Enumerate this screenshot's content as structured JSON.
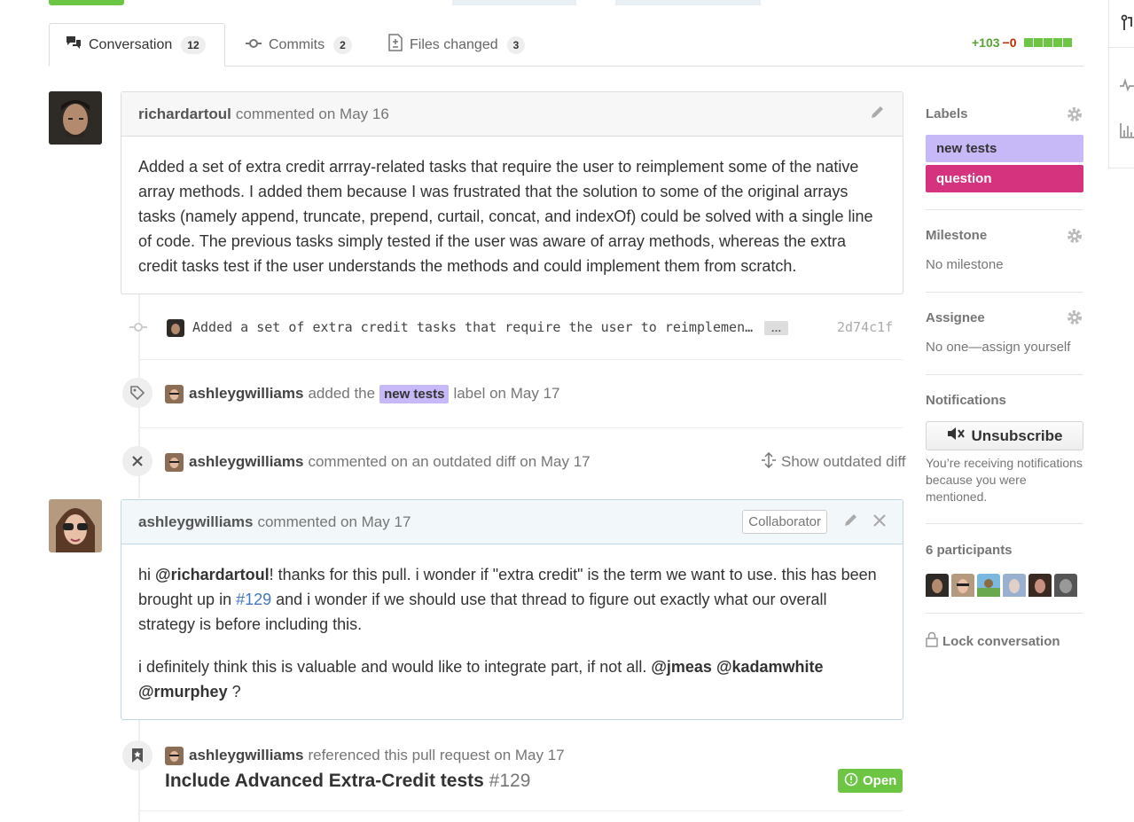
{
  "tabs": [
    {
      "label": "Conversation",
      "count": "12"
    },
    {
      "label": "Commits",
      "count": "2"
    },
    {
      "label": "Files changed",
      "count": "3"
    }
  ],
  "diffstat": {
    "additions": "+103",
    "deletions": "−0"
  },
  "comment1": {
    "author": "richardartoul",
    "action": "commented",
    "date": "on May 16",
    "body": "Added a set of extra credit arrray-related tasks that require the user to reimplement some of the native array methods. I added them because I was frustrated that the solution to some of the original arrays tasks (namely append, truncate, prepend, curtail, concat, and indexOf) could be solved with a single line of code. The previous tasks simply tested if the user was aware of array methods, whereas the extra credit tasks test if the user understands the methods and could implement them from scratch."
  },
  "commit": {
    "message": "Added a set of extra credit tasks that require the user to reimplemen…",
    "ellipsis": "…",
    "sha": "2d74c1f"
  },
  "label_event": {
    "author": "ashleygwilliams",
    "pre": "added the",
    "label": "new tests",
    "post": "label on May 17"
  },
  "outdated_event": {
    "author": "ashleygwilliams",
    "text": "commented on an outdated diff on May 17",
    "show": "Show outdated diff"
  },
  "comment2": {
    "author": "ashleygwilliams",
    "action": "commented",
    "date": "on May 17",
    "badge": "Collaborator",
    "p1_a": "hi ",
    "p1_mention": "@richardartoul",
    "p1_b": "! thanks for this pull. i wonder if \"extra credit\" is the term we want to use. this has been brought up in ",
    "p1_link": "#129",
    "p1_c": " and i wonder if we should use that thread to figure out exactly what our overall strategy is before including this.",
    "p2_a": "i definitely think this is valuable and would like to integrate part, if not all. ",
    "p2_m1": "@jmeas",
    "p2_m2": "@kadamwhite",
    "p2_m3": "@rmurphey",
    "p2_b": " ?"
  },
  "ref_event": {
    "author": "ashleygwilliams",
    "text": "referenced this pull request on May 17",
    "title": "Include Advanced Extra-Credit tests",
    "number": "#129",
    "state": "Open"
  },
  "sidebar": {
    "labels_title": "Labels",
    "labels": [
      {
        "name": "new tests",
        "color": "#c7b8f7"
      },
      {
        "name": "question",
        "color": "#d6337f"
      }
    ],
    "milestone_title": "Milestone",
    "milestone_value": "No milestone",
    "assignee_title": "Assignee",
    "assignee_value": "No one—assign yourself",
    "notifications_title": "Notifications",
    "unsubscribe": "Unsubscribe",
    "notif_reason": "You’re receiving notifications because you were mentioned.",
    "participants_title": "6 participants",
    "lock": "Lock conversation"
  }
}
